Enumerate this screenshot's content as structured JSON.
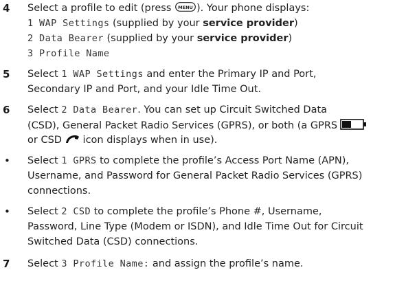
{
  "steps": {
    "s4": {
      "num": "4",
      "pre": "Select a profile to edit (press ",
      "key": "MENU",
      "post": "). Your phone displays:",
      "opt1": {
        "mono": "1 WAP Settings",
        "text": " (supplied by your ",
        "bold": "service provider",
        "end": ")"
      },
      "opt2": {
        "mono": "2 Data Bearer",
        "text": " (supplied by your ",
        "bold": "service provider",
        "end": ")"
      },
      "opt3": {
        "mono": "3 Profile Name"
      }
    },
    "s5": {
      "num": "5",
      "pre": "Select ",
      "mono": "1 WAP Settings",
      "post": " and enter the Primary IP and Port,",
      "line2": "Secondary IP and Port, and your Idle Time Out."
    },
    "s6": {
      "num": "6",
      "pre": "Select ",
      "mono": "2 Data Bearer",
      "post": ". You can set up Circuit Switched Data",
      "line2": "(CSD), General Packet Radio Services (GPRS), or both (a GPRS",
      "line3_mid": "or CSD",
      "line3_end": " icon displays when in use)."
    },
    "b1": {
      "bullet": "•",
      "pre": "Select ",
      "mono": "1 GPRS",
      "post": " to complete the profile’s Access Port Name (APN),",
      "line2": "Username, and Password for General Packet Radio Services (GPRS)",
      "line3": "connections."
    },
    "b2": {
      "bullet": "•",
      "pre": "Select ",
      "mono": "2 CSD",
      "post": " to complete the profile’s Phone #, Username,",
      "line2": "Password, Line Type (Modem or ISDN), and Idle Time Out for Circuit",
      "line3": "Switched Data (CSD) connections."
    },
    "s7": {
      "num": "7",
      "pre": "Select ",
      "mono": "3 Profile Name:",
      "post": " and assign the profile’s name."
    }
  },
  "icons": [
    "menu-key-icon",
    "gprs-battery-icon",
    "csd-handset-icon"
  ]
}
